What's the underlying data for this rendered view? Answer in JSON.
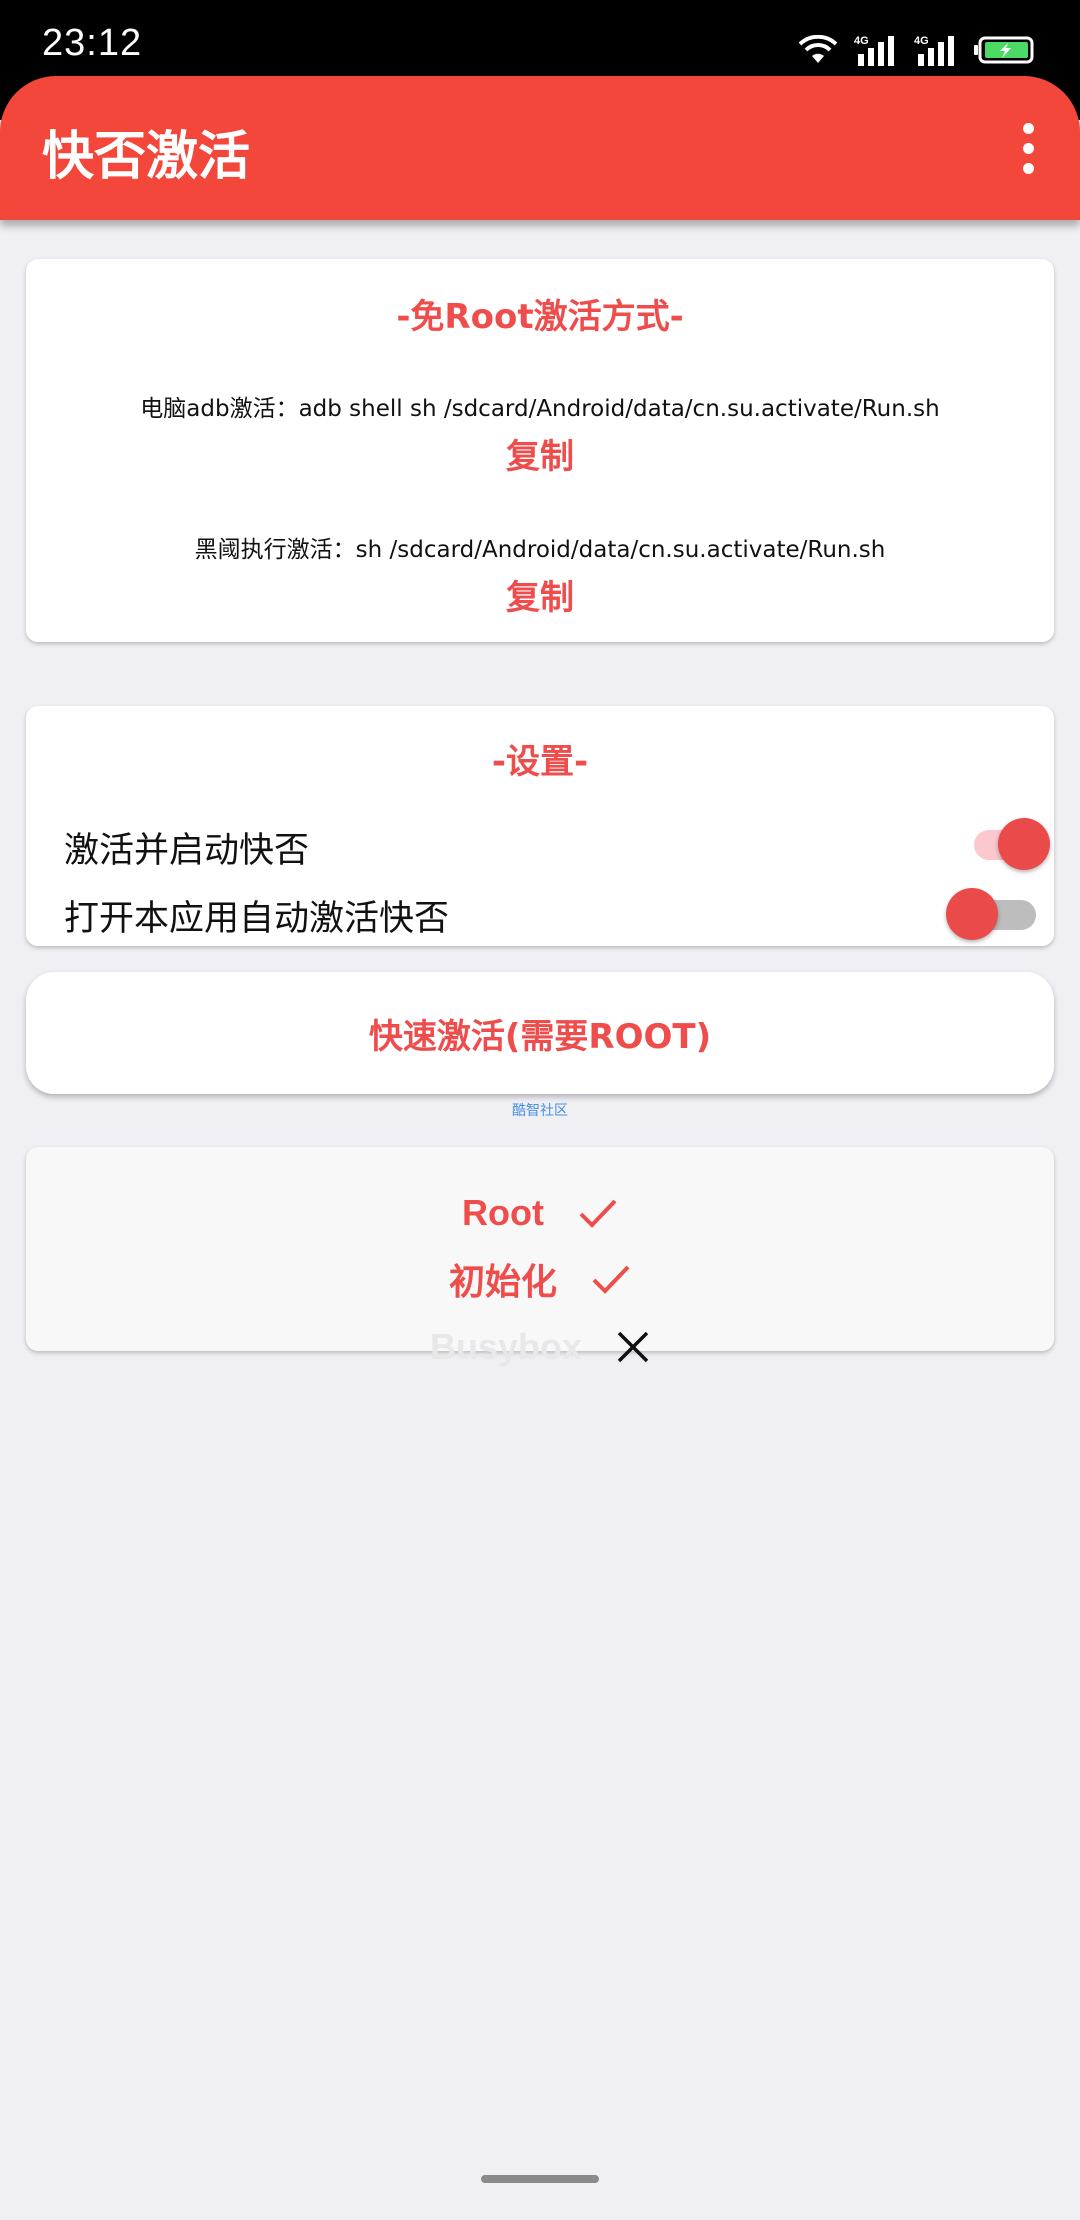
{
  "status_bar": {
    "time": "23:12",
    "net1": "4G",
    "net2": "4G"
  },
  "app_bar": {
    "title": "快否激活"
  },
  "no_root_card": {
    "title": "-免Root激活方式-",
    "adb_cmd": "电脑adb激活：adb shell sh /sdcard/Android/data/cn.su.activate/Run.sh",
    "copy1": "复制",
    "bhy_cmd": "黑阈执行激活：sh /sdcard/Android/data/cn.su.activate/Run.sh",
    "copy2": "复制"
  },
  "settings_card": {
    "title": "-设置-",
    "items": [
      {
        "label": "激活并启动快否",
        "enabled": true
      },
      {
        "label": "打开本应用自动激活快否",
        "enabled": false
      }
    ]
  },
  "activate_button": {
    "label": "快速激活(需要ROOT)"
  },
  "community_link": "酷智社区",
  "checks": [
    {
      "label": "Root",
      "ok": true
    },
    {
      "label": "初始化",
      "ok": true
    },
    {
      "label": "Busybox",
      "ok": false
    }
  ],
  "colors": {
    "accent": "#f4473c",
    "text_red": "#ef4c4c",
    "background": "#efeff4"
  }
}
